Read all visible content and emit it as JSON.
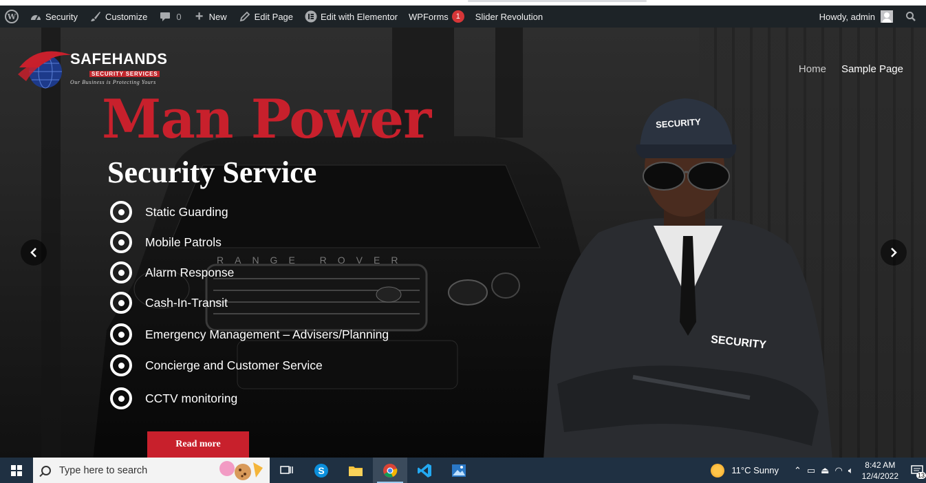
{
  "admin_bar": {
    "site_name": "Security",
    "customize": "Customize",
    "comments_count": "0",
    "new_label": "New",
    "edit_page": "Edit Page",
    "edit_elementor": "Edit with Elementor",
    "wpforms": "WPForms",
    "wpforms_badge": "1",
    "slider_revolution": "Slider Revolution",
    "howdy": "Howdy, admin"
  },
  "logo": {
    "name": "SAFEHANDS",
    "sub": "SECURITY SERVICES",
    "tagline": "Our Business is Protecting Yours"
  },
  "nav": {
    "items": [
      {
        "label": "Home"
      },
      {
        "label": "Sample Page"
      }
    ]
  },
  "hero": {
    "headline": "Man Power",
    "subheadline": "Security Service",
    "services": [
      "Static Guarding",
      "Mobile Patrols",
      "Alarm Response",
      "Cash-In-Transit",
      "Emergency Management – Advisers/Planning",
      "Concierge and Customer Service",
      "CCTV monitoring"
    ],
    "button": "Read more",
    "car_badge": "RANGE ROVER",
    "cap_text": "SECURITY",
    "jacket_text": "SECURITY"
  },
  "taskbar": {
    "search_placeholder": "Type here to search",
    "weather": "11°C  Sunny",
    "time": "8:42 AM",
    "date": "12/4/2022",
    "notifications": "13"
  },
  "colors": {
    "accent_red": "#c8202c",
    "admin_bar": "#1d2327",
    "taskbar": "#1f3042"
  }
}
